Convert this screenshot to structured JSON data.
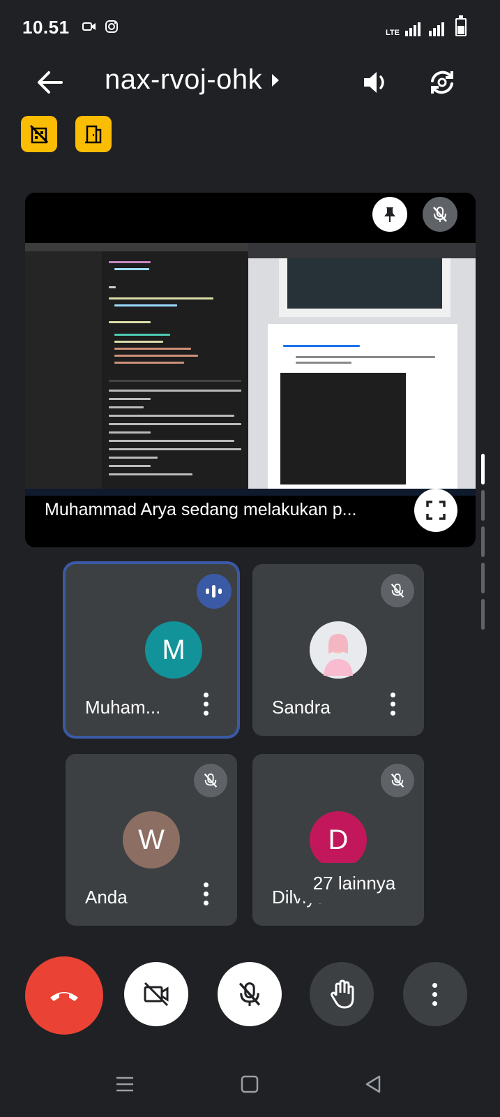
{
  "status_bar": {
    "time": "10.51",
    "network_label": "LTE",
    "icons": [
      "video-camera-icon",
      "instagram-icon",
      "signal-icon",
      "battery-icon"
    ]
  },
  "header": {
    "meeting_code": "nax-rvoj-ohk",
    "icons": [
      "back-arrow-icon",
      "speaker-icon",
      "switch-camera-icon"
    ]
  },
  "chips": [
    "no-building-icon",
    "door-exit-icon"
  ],
  "presentation": {
    "caption": "Muhammad Arya sedang melakukan p...",
    "icons": [
      "pin-icon",
      "mic-off-icon",
      "fullscreen-icon"
    ]
  },
  "participants": [
    {
      "name": "Muham...",
      "initial": "M",
      "avatar_color": "#12939a",
      "speaking": true
    },
    {
      "name": "Sandra",
      "initial": "",
      "avatar_color": "#e8eaed",
      "muted": true
    },
    {
      "name": "Anda",
      "initial": "W",
      "avatar_color": "#8d6e63",
      "muted": true
    },
    {
      "name": "Dilviyo",
      "initial": "D",
      "avatar_color": "#c2185b",
      "muted": true
    }
  ],
  "overflow": {
    "label": "27 lainnya"
  },
  "controls": [
    "end-call-icon",
    "camera-off-icon",
    "mic-off-icon",
    "raise-hand-icon",
    "more-options-icon"
  ],
  "colors": {
    "background": "#202124",
    "tile": "#3c4043",
    "active_outline": "#3b5aa5",
    "end_call": "#ea4335",
    "chip": "#fbbc04"
  }
}
